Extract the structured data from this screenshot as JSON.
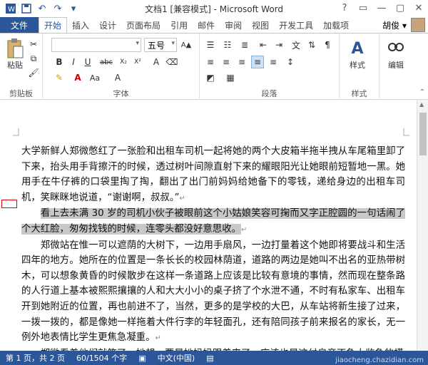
{
  "window": {
    "title": "文档1 [兼容模式] - Microsoft Word",
    "controls": [
      "?",
      "▭",
      "—",
      "▢",
      "✕"
    ]
  },
  "qat": {
    "icons": [
      "word-icon",
      "save-icon",
      "undo-icon",
      "redo-icon",
      "customize-icon"
    ]
  },
  "tabs": {
    "file": "文件",
    "items": [
      "开始",
      "插入",
      "设计",
      "页面布局",
      "引用",
      "邮件",
      "审阅",
      "视图",
      "开发工具",
      "加载项"
    ],
    "active": "开始",
    "user": "胡俊 ▾"
  },
  "ribbon": {
    "clipboard": {
      "paste": "粘贴",
      "label": "剪贴板"
    },
    "font": {
      "size": "五号",
      "label": "字体"
    },
    "paragraph": {
      "label": "段落"
    },
    "styles": {
      "btn": "样式",
      "label": "样式"
    },
    "editing": {
      "btn": "编辑"
    }
  },
  "document": {
    "p1": "大学新鲜人郑微憋红了一张脸和出租车司机一起将她的两个大皮箱半拖半拽从车尾箱里卸了下来，抬头用手背擦汗的时候，透过树叶间隙直射下来的耀眼阳光让她眼前短暂地一黑。她用手在牛仔裤的口袋里掏了掏，翻出了出门前妈妈给她备下的零钱，递给身边的出租车司机，笑眯眯地说道，“谢谢啊，叔叔。”",
    "p2": "看上去未满 30 岁的司机小伙子被眼前这个小姑娘笑容可掬而又字正腔圆的一句话闹了个大红脸，匆匆找钱的时候，连零头都没好意思收。",
    "p3": "郑微站在惟一可以遮荫的大树下，一边用手扇风，一边打量着这个她即将要战斗和生活四年的地方。她所在的位置是一条长长的校园林荫道，道路的两边是她叫不出名的亚热带树木，可以想象黄昏的时候散步在这样一条道路上应该是比较有意境的事情，然而现在整条路的人行道上基本被熙熙攘攘的人和大大小小的桌子挤了个水泄不通，不时有私家车、出租车开到她附近的位置，再也前进不了，当然，更多的是学校的大巴，从车站将新生接了过来，一拨一拨的，都是像她一样拖着大件行李的年轻面孔，还有陪同孩子前来报名的家长，无一例外地表情比学生更焦急凝重。",
    "p4": "郑微看着他们就笑了，她想，要是她妈妈跟着来了，应该也是这付皇帝不急太监急的模"
  },
  "status": {
    "page": "第 1 页，共 2 页",
    "words": "60/1504 个字",
    "lang": "中文(中国)"
  },
  "watermark": "jiaocheng.chazidian.com",
  "colors": {
    "accent": "#2b579a",
    "selection": "#c8c8c8",
    "annotation": "#dd0000"
  }
}
